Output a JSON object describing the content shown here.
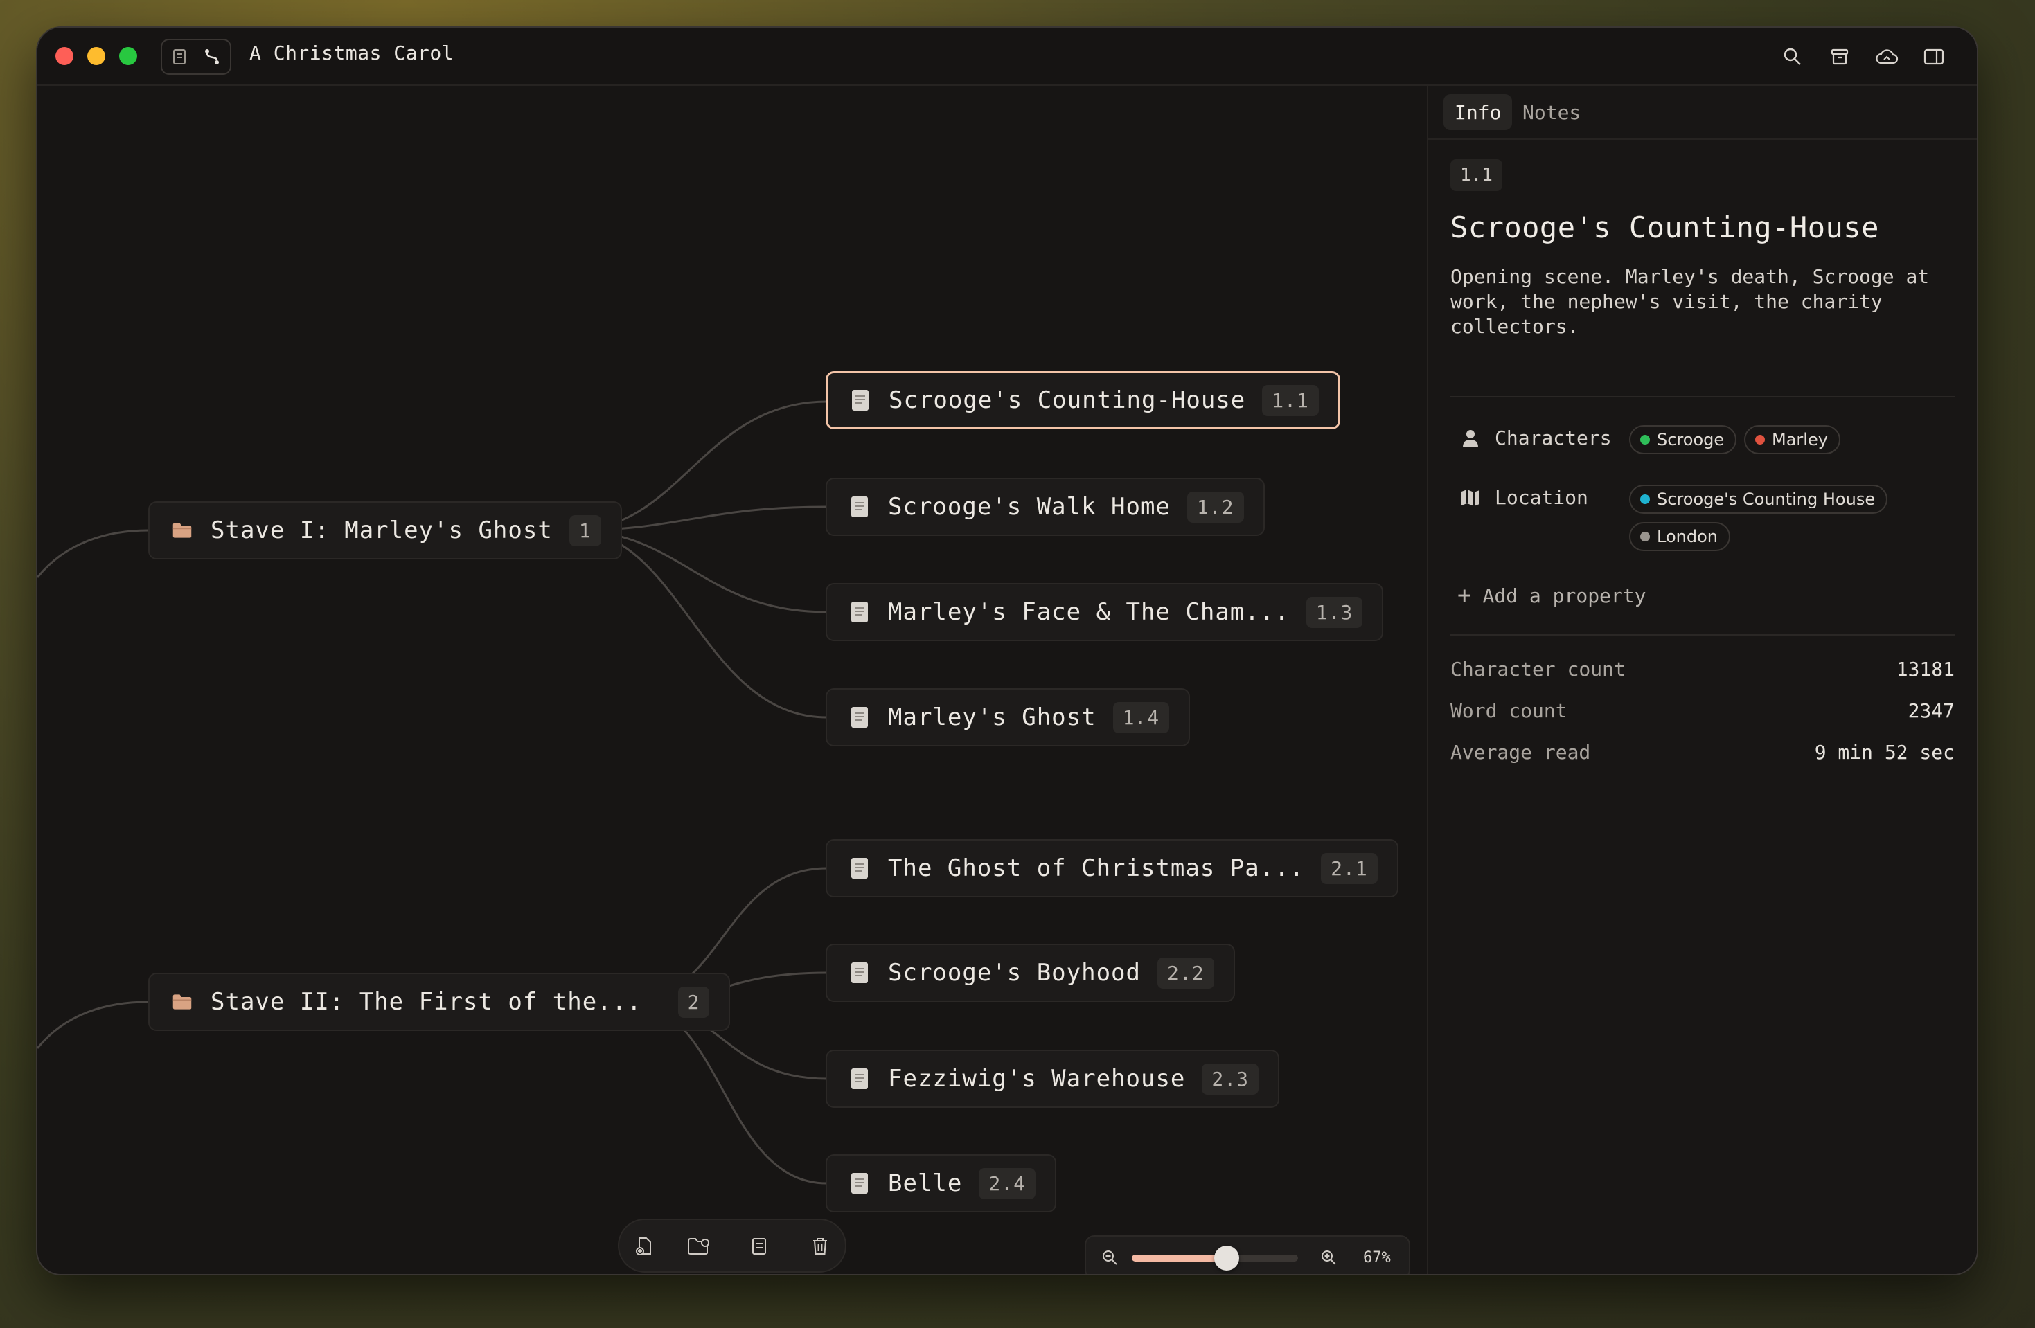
{
  "window": {
    "title": "A Christmas Carol"
  },
  "canvas": {
    "groups": [
      {
        "label": "Stave I: Marley's Ghost",
        "badge": "1",
        "children": [
          {
            "label": "Scrooge's Counting-House",
            "badge": "1.1",
            "selected": true
          },
          {
            "label": "Scrooge's Walk Home",
            "badge": "1.2"
          },
          {
            "label": "Marley's Face & The Cham...",
            "badge": "1.3"
          },
          {
            "label": "Marley's Ghost",
            "badge": "1.4"
          }
        ]
      },
      {
        "label": "Stave II: The First of the...",
        "badge": "2",
        "children": [
          {
            "label": "The Ghost of Christmas Pa...",
            "badge": "2.1"
          },
          {
            "label": "Scrooge's Boyhood",
            "badge": "2.2"
          },
          {
            "label": "Fezziwig's Warehouse",
            "badge": "2.3"
          },
          {
            "label": "Belle",
            "badge": "2.4"
          }
        ]
      }
    ],
    "zoom": {
      "label": "67%",
      "value": 0.67
    }
  },
  "panel": {
    "tabs": [
      "Info",
      "Notes"
    ],
    "badge": "1.1",
    "title": "Scrooge's Counting-House",
    "description": "Opening scene. Marley's death, Scrooge at work, the nephew's visit, the charity collectors.",
    "properties": {
      "characters": {
        "label": "Characters",
        "chips": [
          {
            "name": "Scrooge",
            "color": "#2fbf5a"
          },
          {
            "name": "Marley",
            "color": "#e0523f"
          }
        ]
      },
      "location": {
        "label": "Location",
        "chips": [
          {
            "name": "Scrooge's Counting House",
            "color": "#1fb3d1"
          },
          {
            "name": "London",
            "color": "#9a958f"
          }
        ]
      }
    },
    "add_property": "Add a property",
    "stats": [
      {
        "label": "Character count",
        "value": "13181"
      },
      {
        "label": "Word count",
        "value": "2347"
      },
      {
        "label": "Average read",
        "value": "9 min 52 sec"
      }
    ]
  },
  "colors": {
    "accent": "#f4b9a3",
    "folder": "#d9a383",
    "selected_border": "#f3c4a8"
  }
}
